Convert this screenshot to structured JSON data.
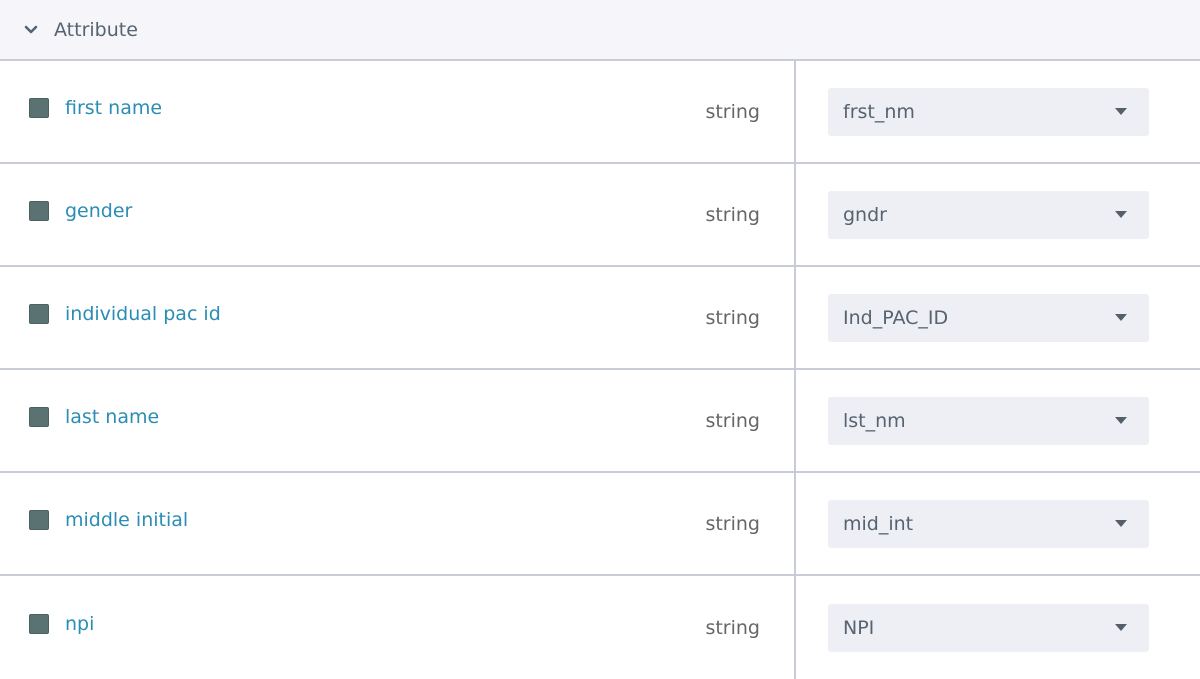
{
  "section": {
    "title": "Attribute",
    "collapse_icon": "chevron-down-icon"
  },
  "attributes": [
    {
      "name": "first name",
      "type": "string",
      "mapping": "frst_nm"
    },
    {
      "name": "gender",
      "type": "string",
      "mapping": "gndr"
    },
    {
      "name": "individual pac id",
      "type": "string",
      "mapping": "Ind_PAC_ID"
    },
    {
      "name": "last name",
      "type": "string",
      "mapping": "lst_nm"
    },
    {
      "name": "middle initial",
      "type": "string",
      "mapping": "mid_int"
    },
    {
      "name": "npi",
      "type": "string",
      "mapping": "NPI"
    }
  ],
  "colors": {
    "attribute_link": "#2a8db4",
    "checkbox_fill": "#5a7272",
    "select_bg": "#eeeff4",
    "divider": "#c8ccd6"
  }
}
